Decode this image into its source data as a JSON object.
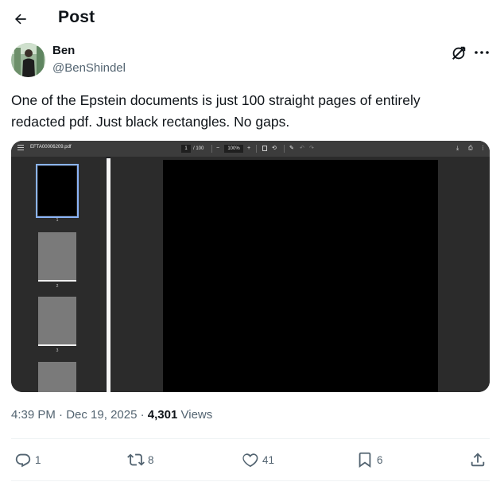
{
  "header": {
    "title": "Post"
  },
  "author": {
    "name": "Ben",
    "handle": "@BenShindel"
  },
  "tweet": {
    "text_line1": "One of the Epstein documents is just 100 straight pages of entirely",
    "text_line2": "redacted pdf.  Just black rectangles.  No gaps."
  },
  "pdf_viewer": {
    "filename": "EFTA00006209.pdf",
    "current_page": "1",
    "total_pages": "/ 100",
    "zoom_minus": "−",
    "zoom": "100%",
    "zoom_plus": "+",
    "thumbnails": [
      "1",
      "2",
      "3"
    ]
  },
  "meta": {
    "time": "4:39 PM",
    "separator": "·",
    "date": "Dec 19, 2025",
    "views_count": "4,301",
    "views_label": "Views"
  },
  "actions": {
    "replies": "1",
    "reposts": "8",
    "likes": "41",
    "bookmarks": "6"
  },
  "colors": {
    "text": "#0f1419",
    "secondary": "#536471",
    "divider": "#eff3f4"
  }
}
